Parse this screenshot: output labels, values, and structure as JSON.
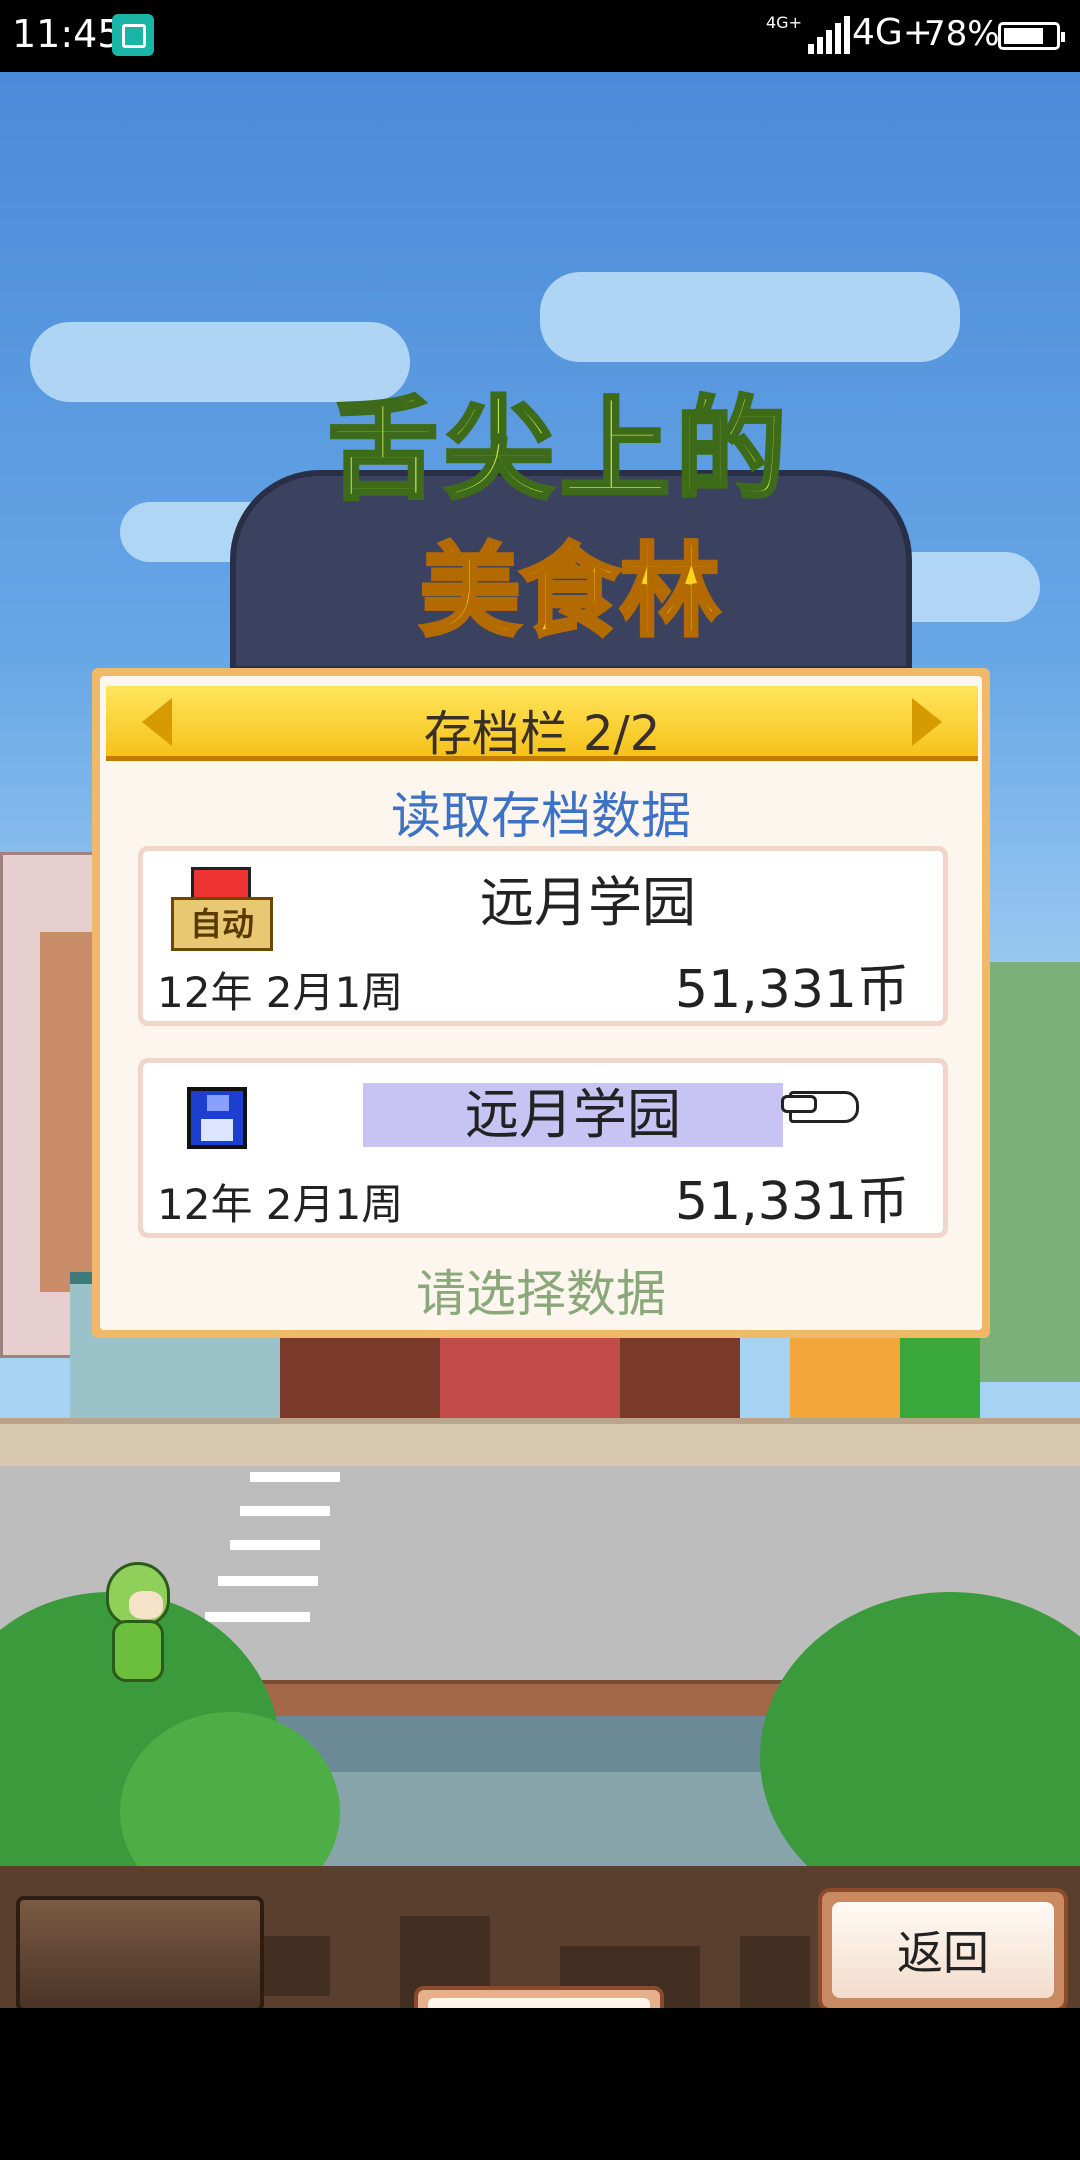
{
  "status_bar": {
    "time": "11:45",
    "network_small": "4G+",
    "network": "4G+",
    "battery": "78%",
    "battery_level": 0.78
  },
  "logo": {
    "line1": "舌尖上的",
    "line2": "美食林"
  },
  "dialog": {
    "title": "存档栏 2/2",
    "subtitle": "读取存档数据",
    "slots": [
      {
        "type": "auto",
        "badge": "自动",
        "name": "远月学园",
        "date": "12年 2月1周",
        "money": "51,331币",
        "selected": false
      },
      {
        "type": "manual",
        "name": "远月学园",
        "date": "12年 2月1周",
        "money": "51,331币",
        "selected": true
      }
    ],
    "hint": "请选择数据"
  },
  "bottom_bar": {
    "return_label": "返回"
  },
  "colors": {
    "dialog_frame": "#f1b86a",
    "header_gold": "#f5c21a",
    "subtitle_blue": "#3d72c5",
    "hint_green": "#8aa87a",
    "selection": "#c7c4f4"
  }
}
